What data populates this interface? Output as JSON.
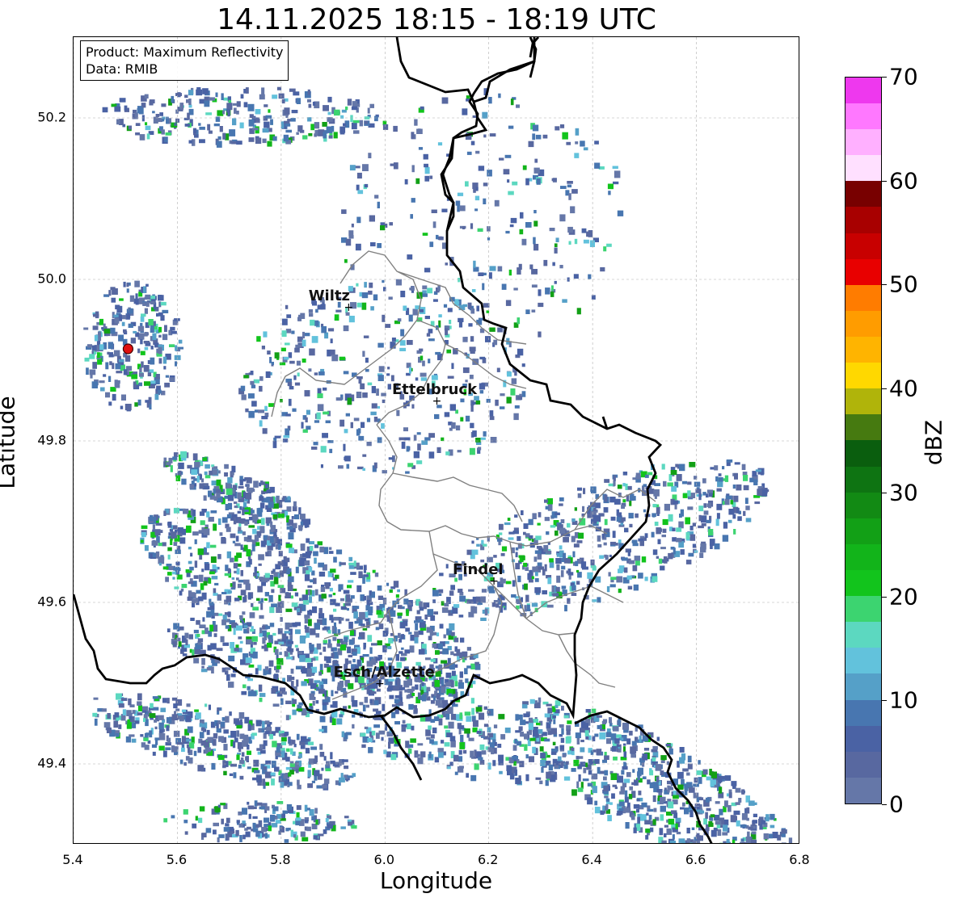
{
  "title": "14.11.2025 18:15 - 18:19 UTC",
  "info": {
    "product": "Product: Maximum Reflectivity",
    "data": "Data: RMIB"
  },
  "axes": {
    "xlabel": "Longitude",
    "ylabel": "Latitude",
    "xlim": [
      5.4,
      6.8
    ],
    "ylim": [
      49.3,
      50.3
    ],
    "xticks": [
      "5.4",
      "5.6",
      "5.8",
      "6.0",
      "6.2",
      "6.4",
      "6.6",
      "6.8"
    ],
    "yticks": [
      "49.4",
      "49.6",
      "49.8",
      "50.0",
      "50.2"
    ],
    "grid": true
  },
  "colorbar": {
    "label": "dBZ",
    "ticks": [
      "0",
      "10",
      "20",
      "30",
      "40",
      "50",
      "60",
      "70"
    ],
    "range": [
      0,
      70
    ],
    "colors": [
      "#6577a8",
      "#5868a0",
      "#4a62a4",
      "#4876b0",
      "#55a0c8",
      "#62c2dc",
      "#5cd8c0",
      "#3cd470",
      "#12c41c",
      "#12b41a",
      "#12a016",
      "#128a14",
      "#0e7412",
      "#0a5e0e",
      "#467a10",
      "#b0b40a",
      "#ffd800",
      "#ffb400",
      "#ff9c00",
      "#ff7c00",
      "#e80000",
      "#c80000",
      "#a80000",
      "#780000",
      "#ffe0ff",
      "#ffb0ff",
      "#ff78ff",
      "#ee38ee"
    ]
  },
  "places": [
    {
      "name": "Wiltz",
      "lon": 5.93,
      "lat": 49.966
    },
    {
      "name": "Ettelbruck",
      "lon": 6.1,
      "lat": 49.85
    },
    {
      "name": "Findel",
      "lon": 6.21,
      "lat": 49.627
    },
    {
      "name": "Esch/Alzette",
      "lon": 5.99,
      "lat": 49.5
    }
  ],
  "radar_site": {
    "lon": 5.505,
    "lat": 49.914
  },
  "colors": {
    "border": "#000000",
    "canton": "#808080",
    "grid": "#b0b0b0"
  }
}
